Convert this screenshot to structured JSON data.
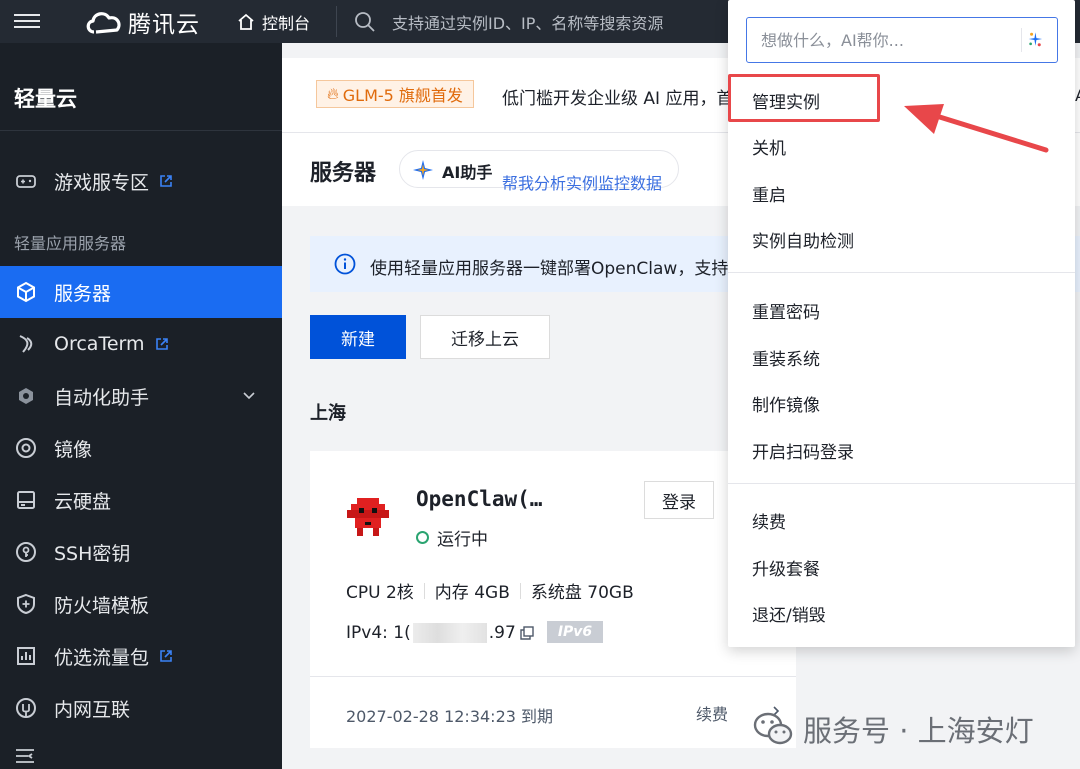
{
  "topbar": {
    "brand": "腾讯云",
    "console_label": "控制台",
    "search_placeholder": "支持通过实例ID、IP、名称等搜索资源"
  },
  "sidebar": {
    "title": "轻量云",
    "group_label": "轻量应用服务器",
    "items": [
      {
        "label": "游戏服专区",
        "icon": "gamepad-icon",
        "external": true
      },
      {
        "label": "服务器",
        "icon": "cube-icon",
        "active": true
      },
      {
        "label": "OrcaTerm",
        "icon": "terminal-icon",
        "external": true
      },
      {
        "label": "自动化助手",
        "icon": "robot-icon",
        "expandable": true
      },
      {
        "label": "镜像",
        "icon": "disc-icon"
      },
      {
        "label": "云硬盘",
        "icon": "hard-disk-icon"
      },
      {
        "label": "SSH密钥",
        "icon": "key-icon"
      },
      {
        "label": "防火墙模板",
        "icon": "shield-icon"
      },
      {
        "label": "优选流量包",
        "icon": "bar-chart-icon",
        "external": true
      },
      {
        "label": "内网互联",
        "icon": "network-icon"
      }
    ]
  },
  "announcement": {
    "badge": "GLM-5 旗舰首发",
    "text": "低门槛开发企业级 AI 应用，首"
  },
  "page": {
    "title": "服务器",
    "ai_label": "AI助手",
    "ai_hint": "帮我分析实例监控数据",
    "info_text": "使用轻量应用服务器一键部署OpenClaw，支持",
    "new_button": "新建",
    "migrate_button": "迁移上云",
    "region": "上海"
  },
  "instance": {
    "name": "OpenClaw(…",
    "status": "运行中",
    "login_button": "登录",
    "cpu": "CPU 2核",
    "memory": "内存 4GB",
    "disk": "系统盘 70GB",
    "ipv4_prefix": "IPv4: 1(",
    "ipv4_suffix": ".97",
    "ipv6_badge": "IPv6",
    "expire": "2027-02-28 12:34:23 到期",
    "renew": "续费"
  },
  "dropdown": {
    "ai_placeholder": "想做什么，AI帮你...",
    "group1": [
      "管理实例",
      "关机",
      "重启",
      "实例自助检测"
    ],
    "group2": [
      "重置密码",
      "重装系统",
      "制作镜像",
      "开启扫码登录"
    ],
    "group3": [
      "续费",
      "升级套餐",
      "退还/销毁"
    ]
  },
  "watermark": "服务号 · 上海安灯",
  "right_edge_text": "A"
}
